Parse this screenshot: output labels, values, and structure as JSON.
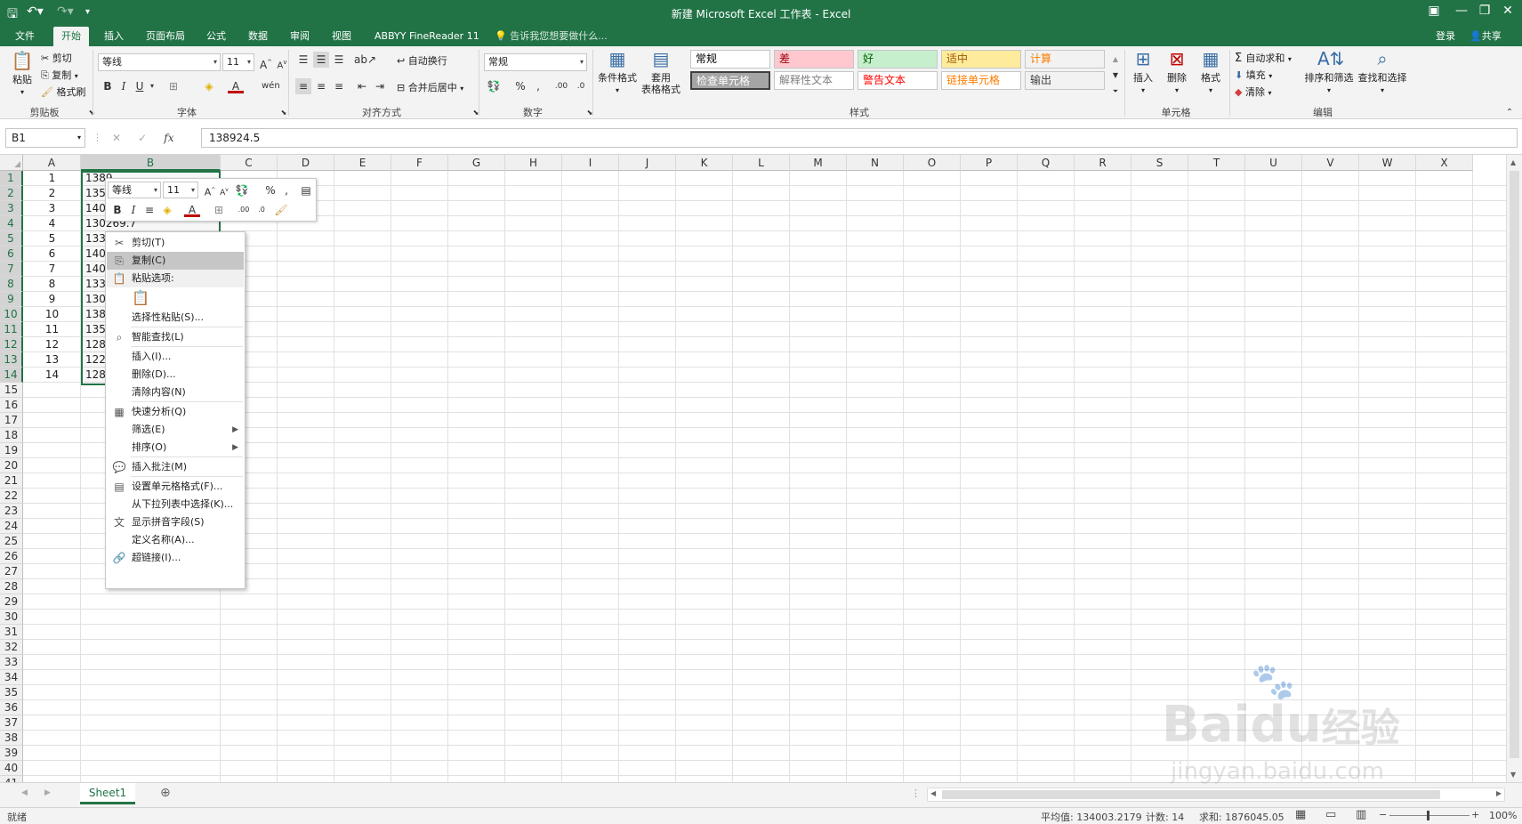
{
  "title_bar": {
    "title": "新建 Microsoft Excel 工作表 - Excel",
    "save_icon": "save-icon",
    "undo_icon": "undo-icon",
    "redo_icon": "redo-icon"
  },
  "tabs": [
    "文件",
    "开始",
    "插入",
    "页面布局",
    "公式",
    "数据",
    "审阅",
    "视图",
    "ABBYY FineReader 11"
  ],
  "active_tab": "开始",
  "tell_me": "告诉我您想要做什么...",
  "account": {
    "login": "登录",
    "share": "共享"
  },
  "ribbon": {
    "clipboard": {
      "label": "剪贴板",
      "paste": "粘贴",
      "cut": "剪切",
      "copy": "复制",
      "format_painter": "格式刷"
    },
    "font": {
      "label": "字体",
      "name": "等线",
      "size": "11"
    },
    "alignment": {
      "label": "对齐方式",
      "wrap": "自动换行",
      "merge": "合并后居中"
    },
    "number": {
      "label": "数字",
      "format": "常规"
    },
    "styles": {
      "label": "样式",
      "conditional": "条件格式",
      "table_line1": "套用",
      "table_line2": "表格格式",
      "cells": [
        {
          "name": "常规",
          "bg": "#ffffff",
          "fg": "#000000"
        },
        {
          "name": "差",
          "bg": "#ffc7ce",
          "fg": "#9c0006"
        },
        {
          "name": "好",
          "bg": "#c6efce",
          "fg": "#006100"
        },
        {
          "name": "适中",
          "bg": "#ffeb9c",
          "fg": "#9c5700"
        },
        {
          "name": "计算",
          "bg": "#f2f2f2",
          "fg": "#fa7d00"
        },
        {
          "name": "检查单元格",
          "bg": "#a5a5a5",
          "fg": "#ffffff"
        },
        {
          "name": "解释性文本",
          "bg": "#ffffff",
          "fg": "#7f7f7f"
        },
        {
          "name": "警告文本",
          "bg": "#ffffff",
          "fg": "#ff0000"
        },
        {
          "name": "链接单元格",
          "bg": "#ffffff",
          "fg": "#fa7d00"
        },
        {
          "name": "输出",
          "bg": "#f2f2f2",
          "fg": "#3f3f3f"
        }
      ]
    },
    "cells_group": {
      "label": "单元格",
      "insert": "插入",
      "delete": "删除",
      "format": "格式"
    },
    "editing": {
      "label": "编辑",
      "autosum": "自动求和",
      "fill": "填充",
      "clear": "清除",
      "sort_line1": "排序和筛选",
      "find_line1": "查找和选择"
    }
  },
  "formula_bar": {
    "name_box": "B1",
    "formula": "138924.5",
    "fx": "fx"
  },
  "columns": [
    "A",
    "B",
    "C",
    "D",
    "E",
    "F",
    "G",
    "H",
    "I",
    "J",
    "K",
    "L",
    "M",
    "N",
    "O",
    "P",
    "Q",
    "R",
    "S",
    "T",
    "U",
    "V",
    "W",
    "X"
  ],
  "rows": [
    "1",
    "2",
    "3",
    "4",
    "5",
    "6",
    "7",
    "8",
    "9",
    "10",
    "11",
    "12",
    "13",
    "14",
    "15",
    "16",
    "17",
    "18",
    "19",
    "20",
    "21",
    "22",
    "23",
    "24",
    "25",
    "26",
    "27",
    "28",
    "29",
    "30",
    "31",
    "32",
    "33",
    "34",
    "35",
    "36",
    "37",
    "38",
    "39",
    "40",
    "41"
  ],
  "col_a_values": [
    "1",
    "2",
    "3",
    "4",
    "5",
    "6",
    "7",
    "8",
    "9",
    "10",
    "11",
    "12",
    "13",
    "14"
  ],
  "col_b_values": [
    "1389",
    "1354",
    "1400",
    "130269.7",
    "1333",
    "1400",
    "1400",
    "1333",
    "1302",
    "1389",
    "1354",
    "1287",
    "1229",
    "1287"
  ],
  "mini_toolbar": {
    "font": "等线",
    "size": "11"
  },
  "context_menu": [
    {
      "label": "剪切(T)",
      "icon": "scissors-icon"
    },
    {
      "label": "复制(C)",
      "icon": "copy-icon",
      "highlight": true
    },
    {
      "label": "粘贴选项:",
      "icon": "paste-icon",
      "section": true
    },
    {
      "label": "选择性粘贴(S)..."
    },
    {
      "label": "智能查找(L)",
      "icon": "search-icon"
    },
    {
      "label": "插入(I)..."
    },
    {
      "label": "删除(D)..."
    },
    {
      "label": "清除内容(N)"
    },
    {
      "label": "快速分析(Q)",
      "icon": "quick-analysis-icon"
    },
    {
      "label": "筛选(E)",
      "submenu": true
    },
    {
      "label": "排序(O)",
      "submenu": true
    },
    {
      "label": "插入批注(M)",
      "icon": "comment-icon"
    },
    {
      "label": "设置单元格格式(F)...",
      "icon": "format-cells-icon"
    },
    {
      "label": "从下拉列表中选择(K)..."
    },
    {
      "label": "显示拼音字段(S)",
      "icon": "phonetic-icon"
    },
    {
      "label": "定义名称(A)..."
    },
    {
      "label": "超链接(I)...",
      "icon": "hyperlink-icon"
    }
  ],
  "sheet_tabs": [
    "Sheet1"
  ],
  "status": {
    "ready": "就绪",
    "average": "平均值: 134003.2179",
    "count": "计数: 14",
    "sum": "求和: 1876045.05",
    "zoom": "100%"
  },
  "watermark": {
    "brand": "Bai",
    "brand2": "du",
    "cn": "经验",
    "url": "jingyan.baidu.com"
  },
  "colors": {
    "accent": "#217346",
    "ribbon": "#f3f3f3"
  }
}
